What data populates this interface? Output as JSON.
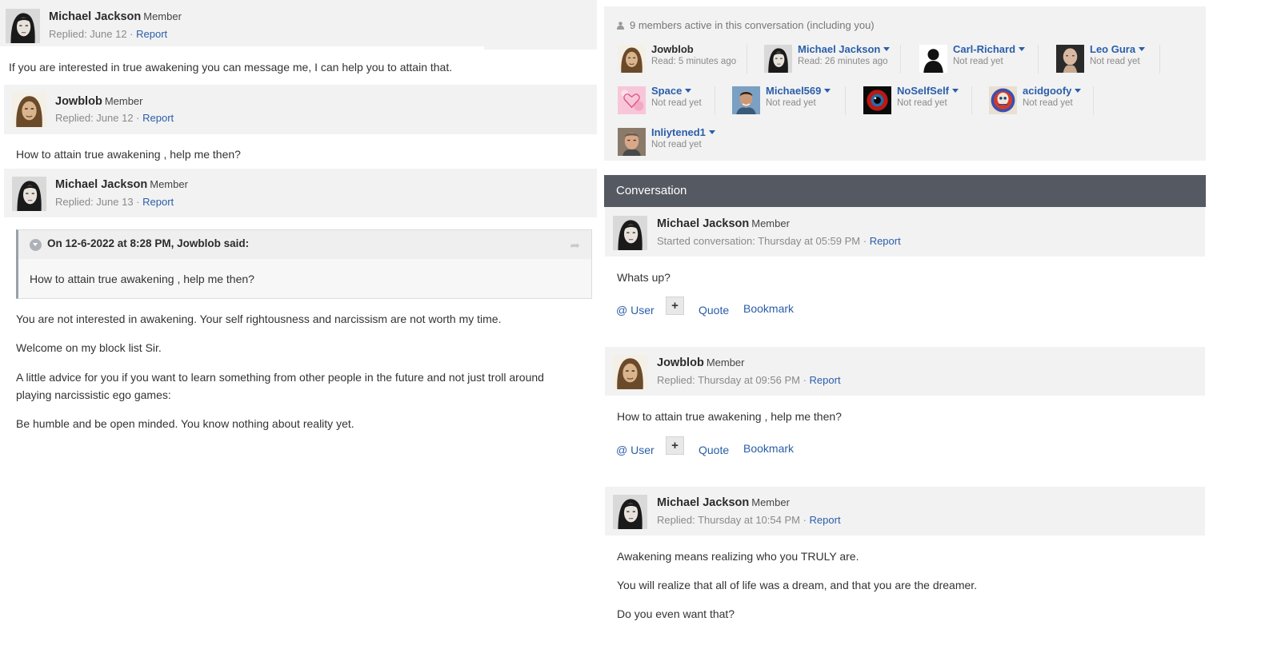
{
  "left_thread": {
    "posts": [
      {
        "author": "Michael Jackson",
        "role": "Member",
        "meta": "Replied: June 12 · ",
        "report": "Report",
        "body": [
          "If you are interested in true awakening you can message me, I can help you to attain that."
        ]
      },
      {
        "author": "Jowblob",
        "role": "Member",
        "meta": "Replied: June 12 · ",
        "report": "Report",
        "body": [
          "How to attain true awakening , help me then?"
        ]
      },
      {
        "author": "Michael Jackson",
        "role": "Member",
        "meta": "Replied: June 13 · ",
        "report": "Report",
        "quote": {
          "author_line": "On 12-6-2022 at 8:28 PM, Jowblob said:",
          "text": "How to attain true awakening , help me then?"
        },
        "body": [
          "You are not interested in awakening. Your self rightousness and narcissism are not worth my time.",
          "Welcome on my block list Sir.",
          "A little advice for you if you want to learn something from other people in the future and not just troll around",
          "playing narcissistic ego games:",
          "Be humble and be open minded. You know nothing about reality yet."
        ]
      }
    ]
  },
  "members_panel": {
    "header": "9 members active in this conversation (including you)",
    "members": [
      {
        "name": "Jowblob",
        "status": "Read: 5 minutes ago",
        "dropdown": false
      },
      {
        "name": "Michael Jackson",
        "status": "Read: 26 minutes ago",
        "dropdown": true
      },
      {
        "name": "Carl-Richard",
        "status": "Not read yet",
        "dropdown": true
      },
      {
        "name": "Leo Gura",
        "status": "Not read yet",
        "dropdown": true
      },
      {
        "name": "Space",
        "status": "Not read yet",
        "dropdown": true
      },
      {
        "name": "Michael569",
        "status": "Not read yet",
        "dropdown": true
      },
      {
        "name": "NoSelfSelf",
        "status": "Not read yet",
        "dropdown": true
      },
      {
        "name": "acidgoofy",
        "status": "Not read yet",
        "dropdown": true
      },
      {
        "name": "Inliytened1",
        "status": "Not read yet",
        "dropdown": true
      }
    ]
  },
  "conversation": {
    "title": "Conversation",
    "posts": [
      {
        "author": "Michael Jackson",
        "role": "Member",
        "meta": "Started conversation: Thursday at 05:59 PM · ",
        "report": "Report",
        "body": [
          "Whats up?"
        ],
        "actions": {
          "user": "@ User",
          "plus": "+",
          "quote": "Quote",
          "bookmark": "Bookmark"
        }
      },
      {
        "author": "Jowblob",
        "role": "Member",
        "meta": "Replied: Thursday at 09:56 PM · ",
        "report": "Report",
        "body": [
          "How to attain true awakening , help me then?"
        ],
        "actions": {
          "user": "@ User",
          "plus": "+",
          "quote": "Quote",
          "bookmark": "Bookmark"
        }
      },
      {
        "author": "Michael Jackson",
        "role": "Member",
        "meta": "Replied: Thursday at 10:54 PM · ",
        "report": "Report",
        "body": [
          "Awakening means realizing who you TRULY are.",
          "You will realize that all of life was a dream, and that you are the dreamer.",
          "Do you even want that?"
        ]
      }
    ]
  },
  "colors": {
    "link": "#2a5ea8",
    "header_bg": "#f2f2f3",
    "conversation_bar": "#555962"
  },
  "icons": {
    "quote_toggle": "chevron-down-circle-icon",
    "quote_share": "share-arrow-icon",
    "members_header": "person-icon",
    "dropdown": "caret-down-icon"
  }
}
